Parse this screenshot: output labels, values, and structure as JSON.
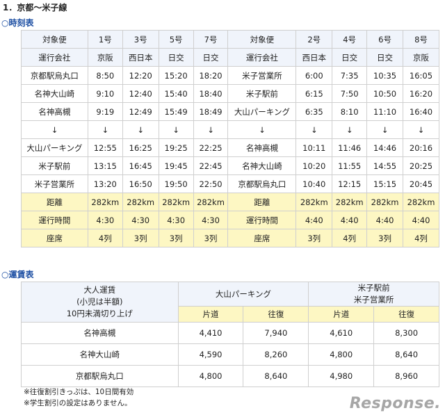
{
  "title": "1．京都〜米子線",
  "timetable": {
    "heading": "○時刻表",
    "rows": [
      [
        "対象便",
        "1号",
        "3号",
        "5号",
        "7号",
        "対象便",
        "2号",
        "4号",
        "6号",
        "8号"
      ],
      [
        "運行会社",
        "京阪",
        "西日本",
        "日交",
        "日交",
        "運行会社",
        "西日本",
        "日交",
        "日交",
        "京阪"
      ],
      [
        "京都駅烏丸口",
        "8:50",
        "12:20",
        "15:20",
        "18:20",
        "米子営業所",
        "6:00",
        "7:35",
        "10:35",
        "16:05"
      ],
      [
        "名神大山崎",
        "9:10",
        "12:40",
        "15:40",
        "18:40",
        "米子駅前",
        "6:15",
        "7:50",
        "10:50",
        "16:20"
      ],
      [
        "名神高槻",
        "9:19",
        "12:49",
        "15:49",
        "18:49",
        "大山パーキング",
        "6:35",
        "8:10",
        "11:10",
        "16:40"
      ],
      [
        "↓",
        "↓",
        "↓",
        "↓",
        "↓",
        "↓",
        "↓",
        "↓",
        "↓",
        "↓"
      ],
      [
        "大山パーキング",
        "12:55",
        "16:25",
        "19:25",
        "22:25",
        "名神高槻",
        "10:11",
        "11:46",
        "14:46",
        "20:16"
      ],
      [
        "米子駅前",
        "13:15",
        "16:45",
        "19:45",
        "22:45",
        "名神大山崎",
        "10:20",
        "11:55",
        "14:55",
        "20:25"
      ],
      [
        "米子営業所",
        "13:20",
        "16:50",
        "19:50",
        "22:50",
        "京都駅烏丸口",
        "10:40",
        "12:15",
        "15:15",
        "20:45"
      ],
      [
        "距離",
        "282km",
        "282km",
        "282km",
        "282km",
        "距離",
        "282km",
        "282km",
        "282km",
        "282km"
      ],
      [
        "運行時間",
        "4:30",
        "4:30",
        "4:30",
        "4:30",
        "運行時間",
        "4:40",
        "4:40",
        "4:40",
        "4:40"
      ],
      [
        "座席",
        "4列",
        "3列",
        "3列",
        "3列",
        "座席",
        "3列",
        "4列",
        "3列",
        "4列"
      ]
    ]
  },
  "fares": {
    "heading": "○運賃表",
    "caption": [
      "大人運賃",
      "(小児は半額)",
      "10円未満切り上げ"
    ],
    "dest1": "大山パーキング",
    "dest2": [
      "米子駅前",
      "米子営業所"
    ],
    "sub": [
      "片道",
      "往復",
      "片道",
      "往復"
    ],
    "rows": [
      [
        "名神高槻",
        "4,410",
        "7,940",
        "4,610",
        "8,300"
      ],
      [
        "名神大山崎",
        "4,590",
        "8,260",
        "4,800",
        "8,640"
      ],
      [
        "京都駅烏丸口",
        "4,800",
        "8,640",
        "4,980",
        "8,960"
      ]
    ]
  },
  "notes": [
    "※往復割引きっぷは、10日間有効",
    "※学生割引の設定はありません。"
  ],
  "watermark": "Response."
}
